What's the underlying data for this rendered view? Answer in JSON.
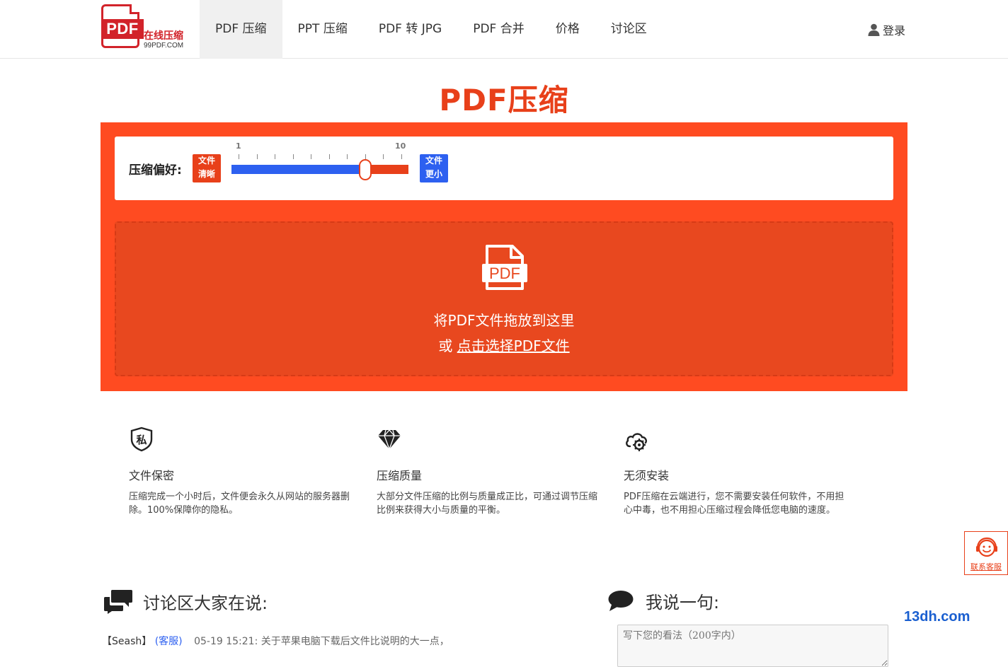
{
  "logo": {
    "badge": "PDF",
    "cn": "在线压缩",
    "en": "99PDF.COM"
  },
  "nav": {
    "items": [
      {
        "label": "PDF 压缩",
        "active": true
      },
      {
        "label": "PPT 压缩"
      },
      {
        "label": "PDF 转 JPG"
      },
      {
        "label": "PDF 合并"
      },
      {
        "label": "价格"
      },
      {
        "label": "讨论区"
      }
    ],
    "login": "登录"
  },
  "title": "PDF压缩",
  "pref": {
    "label": "压缩偏好:",
    "left_tag": [
      "文件",
      "清晰"
    ],
    "right_tag": [
      "文件",
      "更小"
    ],
    "slider": {
      "min": 1,
      "max": 10,
      "min_label": "1",
      "max_label": "10",
      "value": 8
    }
  },
  "dropzone": {
    "icon_label": "PDF",
    "text": "将PDF文件拖放到这里",
    "or": "或",
    "link": "点击选择PDF文件"
  },
  "features": [
    {
      "icon": "shield-private-icon",
      "glyph": "私",
      "title": "文件保密",
      "desc": "压缩完成一个小时后，文件便会永久从网站的服务器删除。100%保障你的隐私。"
    },
    {
      "icon": "diamond-icon",
      "title": "压缩质量",
      "desc": "大部分文件压缩的比例与质量成正比，可通过调节压缩比例来获得大小与质量的平衡。"
    },
    {
      "icon": "cloud-gear-icon",
      "title": "无须安装",
      "desc": "PDF压缩在云端进行，您不需要安装任何软件，不用担心中毒，也不用担心压缩过程会降低您电脑的速度。"
    }
  ],
  "service": {
    "label": "联系客服"
  },
  "discussion": {
    "heading": "讨论区大家在说:",
    "comments": [
      {
        "user": "【Seash】",
        "role": "(客服)",
        "time": "05-19 15:21:",
        "text": "关于苹果电脑下载后文件比说明的大一点，"
      }
    ]
  },
  "say": {
    "heading": "我说一句:",
    "placeholder": "写下您的看法（200字内）"
  },
  "watermark": "13dh.com"
}
